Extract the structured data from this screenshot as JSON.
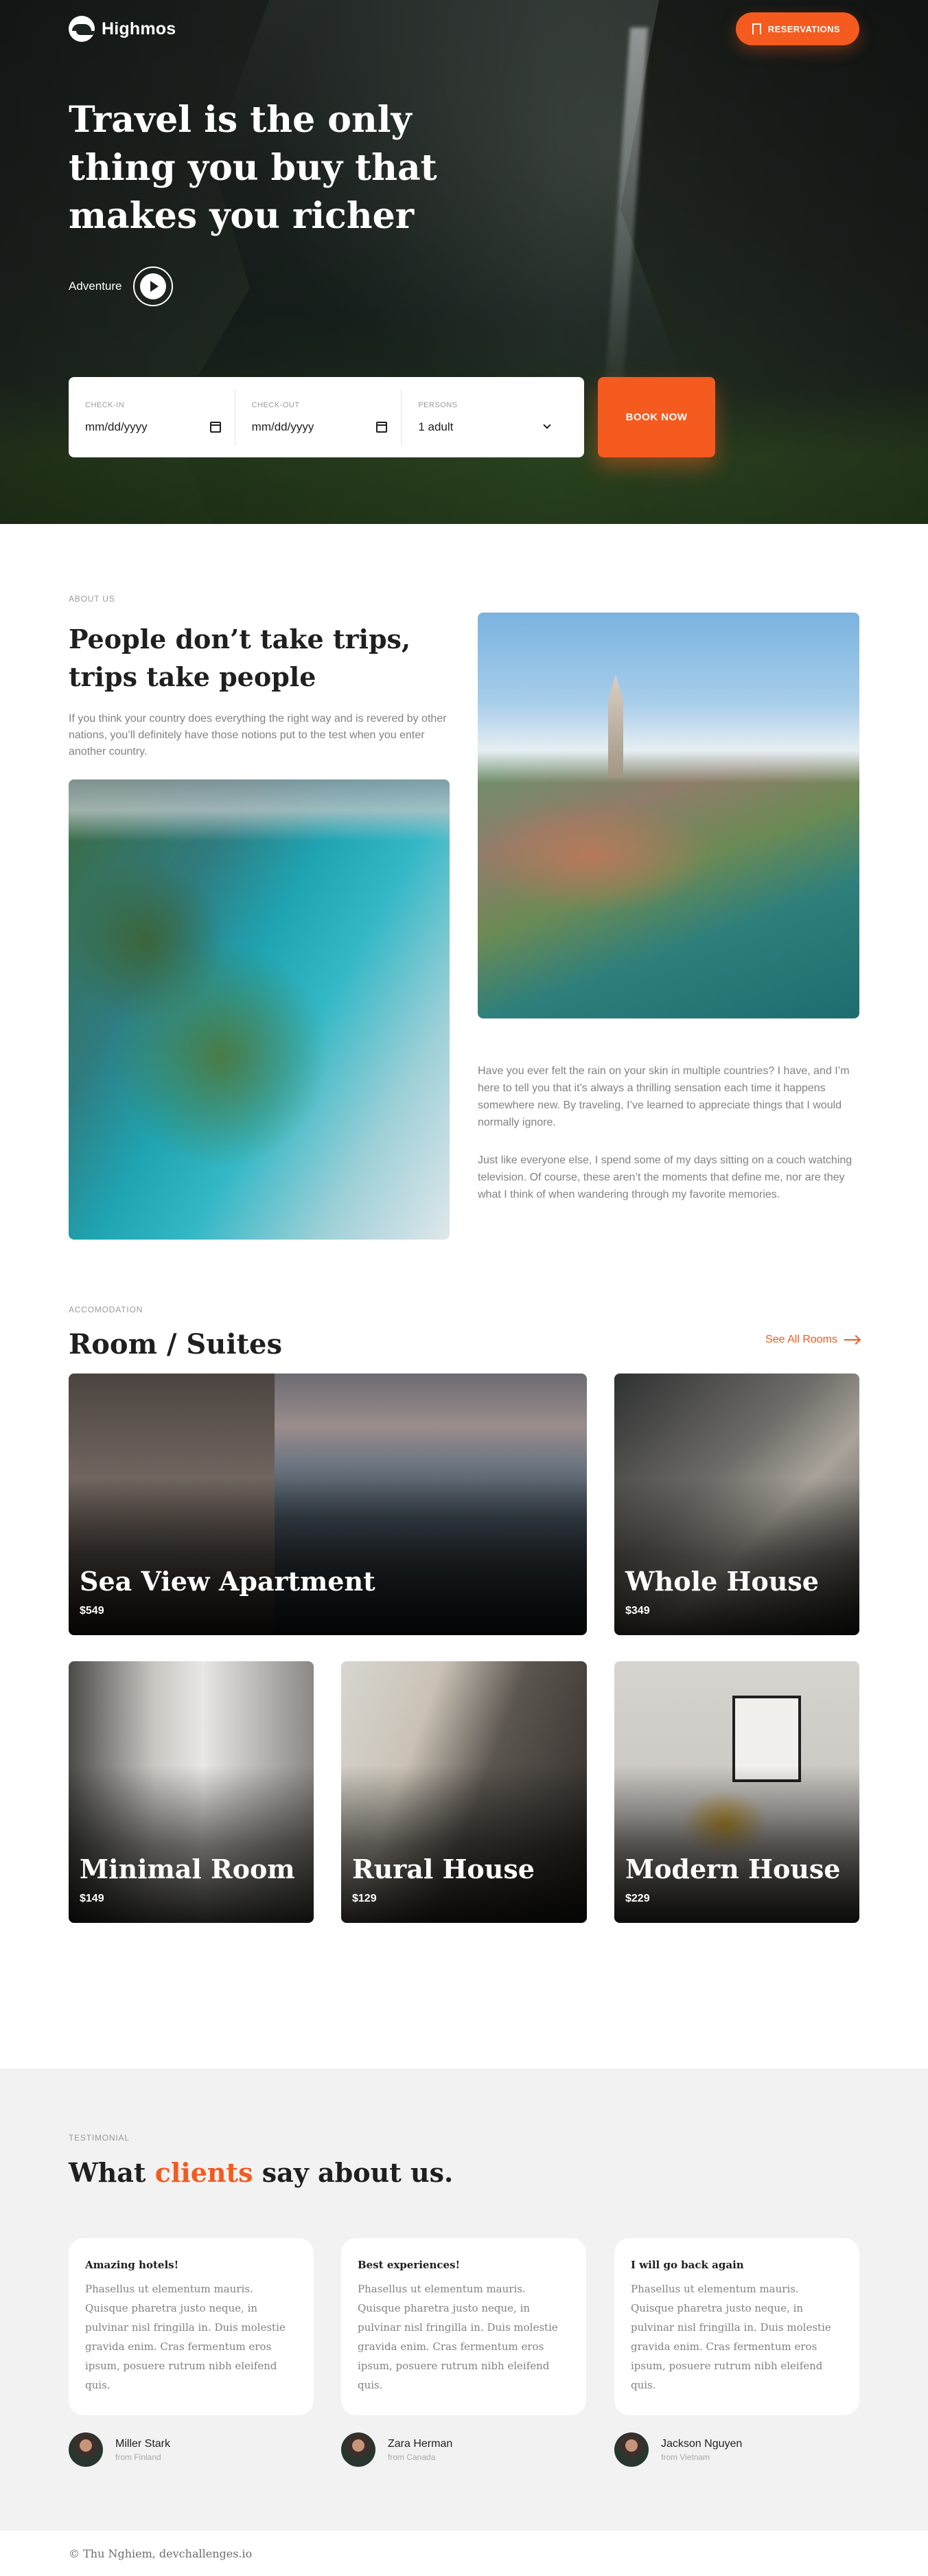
{
  "colors": {
    "accent": "#f55a1e",
    "dark": "#1f1f1f",
    "muted": "#828282",
    "testimonial_bg": "#f2f2f2"
  },
  "nav": {
    "logo_text": "Highmos",
    "reservations_label": "RESERVATIONS",
    "reservations_icon": "bookmark-icon"
  },
  "hero": {
    "title": "Travel is the only thing you buy that makes you richer",
    "adventure_label": "Adventure",
    "play_icon": "play-icon"
  },
  "booking": {
    "check_in": {
      "label": "CHECK-IN",
      "value": "mm/dd/yyyy"
    },
    "check_out": {
      "label": "CHECK-OUT",
      "value": "mm/dd/yyyy"
    },
    "persons": {
      "label": "PERSONS",
      "value": "1 adult"
    },
    "book_label": "BOOK NOW"
  },
  "about": {
    "eyebrow": "ABOUT US",
    "title": "People don’t take trips, trips take people",
    "intro": "If you think your country does everything the right way and is revered by other nations, you’ll definitely have those notions put to the test when you enter another country.",
    "paragraph_1": "Have you ever felt the rain on your skin in multiple countries? I have, and I’m here to tell you that it’s always a thrilling sensation each time it happens somewhere new. By traveling, I’ve learned to appreciate things that I would normally ignore.",
    "paragraph_2": "Just like everyone else, I spend some of my days sitting on a couch watching television. Of course, these aren’t the moments that define me, nor are they what I think of when wandering through my favorite memories."
  },
  "rooms": {
    "eyebrow": "ACCOMODATION",
    "title": "Room / Suites",
    "see_all_label": "See All Rooms",
    "items": [
      {
        "name": "Sea View Apartment",
        "price": "$549"
      },
      {
        "name": "Whole House",
        "price": "$349"
      },
      {
        "name": "Minimal Room",
        "price": "$149"
      },
      {
        "name": "Rural House",
        "price": "$129"
      },
      {
        "name": "Modern House",
        "price": "$229"
      }
    ]
  },
  "testimonials": {
    "eyebrow": "TESTIMONIAL",
    "title_before": "What ",
    "title_accent": "clients",
    "title_after": " say about us.",
    "items": [
      {
        "title": "Amazing hotels!",
        "body": "Phasellus ut elementum mauris. Quisque pharetra justo neque, in pulvinar nisl fringilla in. Duis molestie gravida enim. Cras fermentum eros ipsum, posuere rutrum nibh eleifend quis.",
        "author": "Miller Stark",
        "from": "from Finland"
      },
      {
        "title": "Best experiences!",
        "body": "Phasellus ut elementum mauris. Quisque pharetra justo neque, in pulvinar nisl fringilla in. Duis molestie gravida enim. Cras fermentum eros ipsum, posuere rutrum nibh eleifend quis.",
        "author": "Zara Herman",
        "from": "from Canada"
      },
      {
        "title": "I will go back again",
        "body": "Phasellus ut elementum mauris. Quisque pharetra justo neque, in pulvinar nisl fringilla in. Duis molestie gravida enim. Cras fermentum eros ipsum, posuere rutrum nibh eleifend quis.",
        "author": "Jackson Nguyen",
        "from": "from Vietnam"
      }
    ]
  },
  "footer": {
    "text": "© Thu Nghiem, devchallenges.io"
  }
}
